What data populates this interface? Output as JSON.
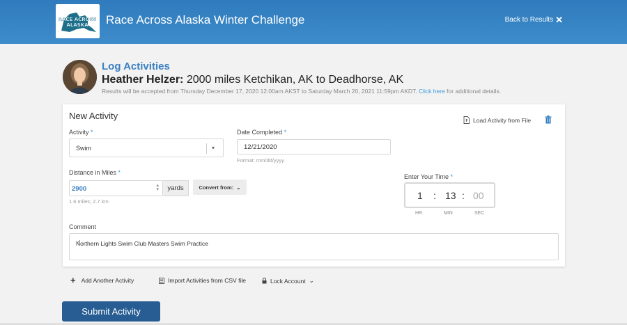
{
  "header": {
    "title": "Race Across Alaska Winter Challenge",
    "back_label": "Back to Results",
    "logo_text_line1": "RACE ACROSS",
    "logo_text_line2": "ALASKA"
  },
  "profile": {
    "section_title": "Log Activities",
    "athlete_name": "Heather Helzer:",
    "race_description": " 2000 miles Ketchikan, AK to Deadhorse, AK",
    "accept_text": "Results will be accepted from Thursday December 17, 2020 12:00am AKST to Saturday March 20, 2021 11:59pm AKDT.",
    "click_here": "Click here",
    "accept_suffix": " for additional details."
  },
  "form": {
    "title": "New Activity",
    "load_file_label": "Load Activity from File",
    "activity_label": "Activity",
    "activity_value": "Swim",
    "date_label": "Date Completed",
    "date_value": "12/21/2020",
    "date_hint": "Format: mm/dd/yyyy",
    "distance_label": "Distance in Miles",
    "distance_value": "2900",
    "distance_unit": "yards",
    "distance_hint": "1.6 miles; 2.7 km",
    "convert_label": "Convert from:",
    "time_label": "Enter Your Time",
    "time_hr": "1",
    "time_min": "13",
    "time_sec": "00",
    "hr_label": "HR",
    "min_label": "MIN",
    "sec_label": "SEC",
    "required_mark": "*",
    "colon": ":",
    "comment_label": "Comment",
    "comment_value": "Northern Lights Swim Club Masters Swim Practice"
  },
  "actions": {
    "add_another": "Add Another Activity",
    "import_csv": "Import Activities from CSV file",
    "lock_account": "Lock Account",
    "submit": "Submit Activity"
  },
  "colors": {
    "header_blue": "#3a85c6",
    "link_blue": "#3a9ad9",
    "submit_blue": "#275d92"
  }
}
